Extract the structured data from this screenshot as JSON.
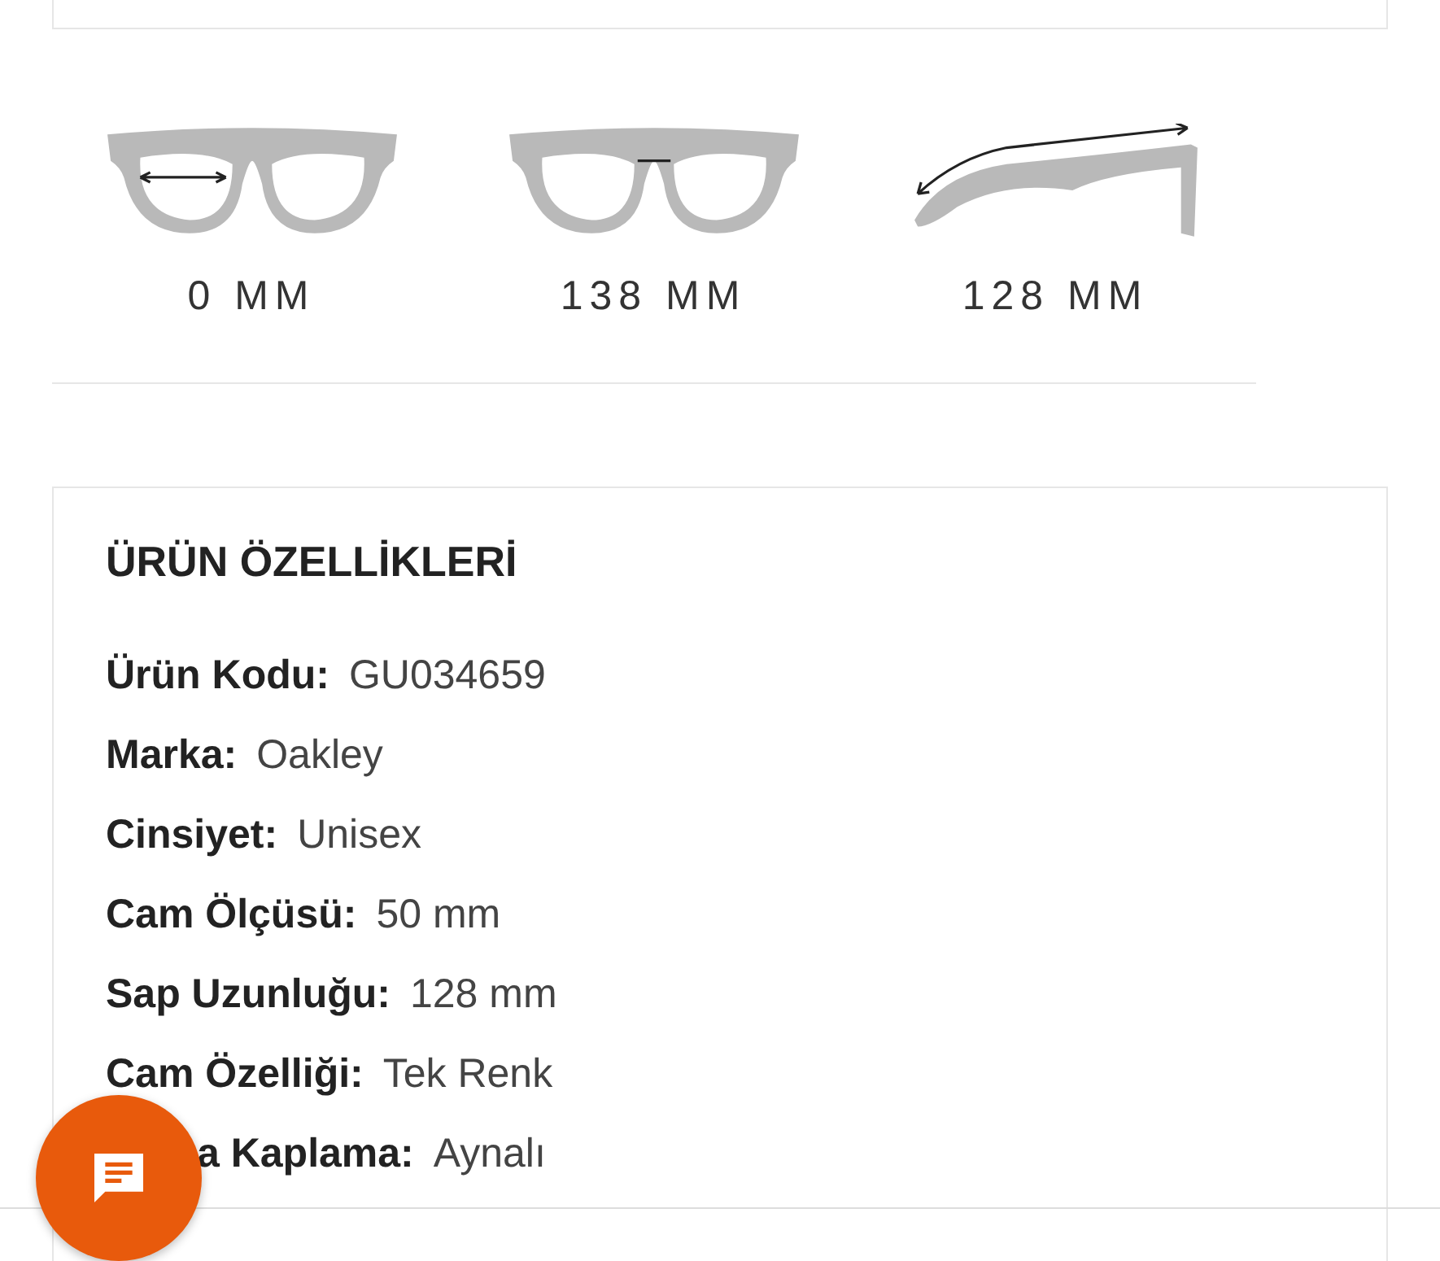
{
  "measurements": [
    {
      "kind": "lens",
      "label": "0 MM"
    },
    {
      "kind": "bridge",
      "label": "138 MM"
    },
    {
      "kind": "temple",
      "label": "128 MM"
    }
  ],
  "features": {
    "title": "ÜRÜN ÖZELLİKLERİ",
    "rows": [
      {
        "kind": "plain",
        "label": "Ürün Kodu:",
        "value": "GU034659"
      },
      {
        "kind": "plain",
        "label": "Marka:",
        "value": "Oakley"
      },
      {
        "kind": "plain",
        "label": "Cinsiyet:",
        "value": "Unisex"
      },
      {
        "kind": "plain",
        "label": "Cam Ölçüsü:",
        "value": "50 mm"
      },
      {
        "kind": "plain",
        "label": "Sap Uzunluğu:",
        "value": "128 mm"
      },
      {
        "kind": "plain",
        "label": "Cam Özelliği:",
        "value": "Tek Renk"
      },
      {
        "kind": "covered",
        "label": "a Kaplama:",
        "value": "Aynalı"
      }
    ]
  }
}
